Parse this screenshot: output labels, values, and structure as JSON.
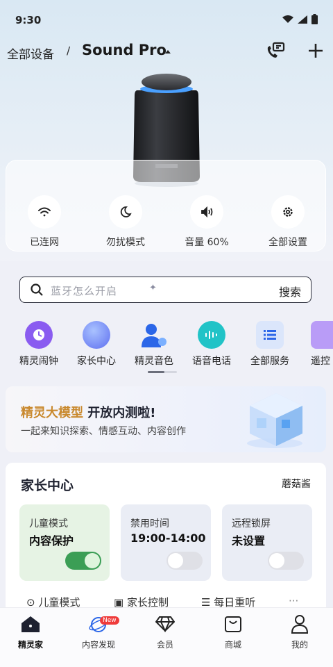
{
  "status_bar": {
    "time": "9:30"
  },
  "header": {
    "breadcrumb": "全部设备",
    "separator": "/",
    "device_name": "Sound Pro"
  },
  "quick_controls": [
    {
      "icon": "wifi-icon",
      "label": "已连网"
    },
    {
      "icon": "moon-icon",
      "label": "勿扰模式"
    },
    {
      "icon": "volume-icon",
      "label": "音量 60%"
    },
    {
      "icon": "gear-icon",
      "label": "全部设置"
    }
  ],
  "search": {
    "placeholder": "蓝牙怎么开启",
    "button": "搜索"
  },
  "services": [
    {
      "icon": "alarm-clock-icon",
      "label": "精灵闹钟"
    },
    {
      "icon": "planet-icon",
      "label": "家长中心"
    },
    {
      "icon": "voice-person-icon",
      "label": "精灵音色"
    },
    {
      "icon": "voice-chat-icon",
      "label": "语音电话"
    },
    {
      "icon": "list-icon",
      "label": "全部服务"
    },
    {
      "icon": "remote-icon",
      "label": "遥控"
    }
  ],
  "banner": {
    "highlight": "精灵大模型",
    "title_rest": "开放内测啦!",
    "subtitle": "一起来知识探索、情感互动、内容创作"
  },
  "parent_center": {
    "title": "家长中心",
    "user": "蘑菇酱",
    "cards": [
      {
        "label": "儿童模式",
        "value": "内容保护",
        "toggle": "on"
      },
      {
        "label": "禁用时间",
        "value": "19:00-14:00",
        "toggle": "off"
      },
      {
        "label": "远程锁屏",
        "value": "未设置",
        "toggle": "off"
      }
    ],
    "sub_links": [
      "儿童模式",
      "家长控制",
      "每日重听"
    ]
  },
  "bottom_nav": {
    "items": [
      {
        "icon": "home-icon",
        "label": "精灵家",
        "active": true
      },
      {
        "icon": "planet-icon",
        "label": "内容发现",
        "badge": "New"
      },
      {
        "icon": "diamond-icon",
        "label": "会员"
      },
      {
        "icon": "shopping-bag-icon",
        "label": "商城"
      },
      {
        "icon": "person-icon",
        "label": "我的"
      }
    ]
  },
  "colors": {
    "accent_gold": "#c9892e",
    "toggle_on": "#3b9e55",
    "badge_red": "#ef3b3b"
  }
}
